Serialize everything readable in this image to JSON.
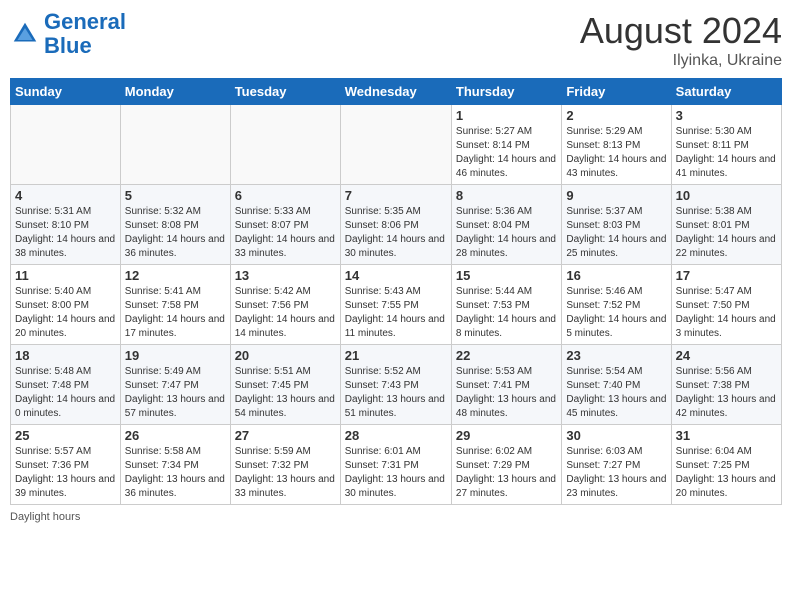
{
  "header": {
    "logo_line1": "General",
    "logo_line2": "Blue",
    "month": "August 2024",
    "location": "Ilyinka, Ukraine"
  },
  "weekdays": [
    "Sunday",
    "Monday",
    "Tuesday",
    "Wednesday",
    "Thursday",
    "Friday",
    "Saturday"
  ],
  "weeks": [
    [
      {
        "day": "",
        "sunrise": "",
        "sunset": "",
        "daylight": ""
      },
      {
        "day": "",
        "sunrise": "",
        "sunset": "",
        "daylight": ""
      },
      {
        "day": "",
        "sunrise": "",
        "sunset": "",
        "daylight": ""
      },
      {
        "day": "",
        "sunrise": "",
        "sunset": "",
        "daylight": ""
      },
      {
        "day": "1",
        "sunrise": "Sunrise: 5:27 AM",
        "sunset": "Sunset: 8:14 PM",
        "daylight": "Daylight: 14 hours and 46 minutes."
      },
      {
        "day": "2",
        "sunrise": "Sunrise: 5:29 AM",
        "sunset": "Sunset: 8:13 PM",
        "daylight": "Daylight: 14 hours and 43 minutes."
      },
      {
        "day": "3",
        "sunrise": "Sunrise: 5:30 AM",
        "sunset": "Sunset: 8:11 PM",
        "daylight": "Daylight: 14 hours and 41 minutes."
      }
    ],
    [
      {
        "day": "4",
        "sunrise": "Sunrise: 5:31 AM",
        "sunset": "Sunset: 8:10 PM",
        "daylight": "Daylight: 14 hours and 38 minutes."
      },
      {
        "day": "5",
        "sunrise": "Sunrise: 5:32 AM",
        "sunset": "Sunset: 8:08 PM",
        "daylight": "Daylight: 14 hours and 36 minutes."
      },
      {
        "day": "6",
        "sunrise": "Sunrise: 5:33 AM",
        "sunset": "Sunset: 8:07 PM",
        "daylight": "Daylight: 14 hours and 33 minutes."
      },
      {
        "day": "7",
        "sunrise": "Sunrise: 5:35 AM",
        "sunset": "Sunset: 8:06 PM",
        "daylight": "Daylight: 14 hours and 30 minutes."
      },
      {
        "day": "8",
        "sunrise": "Sunrise: 5:36 AM",
        "sunset": "Sunset: 8:04 PM",
        "daylight": "Daylight: 14 hours and 28 minutes."
      },
      {
        "day": "9",
        "sunrise": "Sunrise: 5:37 AM",
        "sunset": "Sunset: 8:03 PM",
        "daylight": "Daylight: 14 hours and 25 minutes."
      },
      {
        "day": "10",
        "sunrise": "Sunrise: 5:38 AM",
        "sunset": "Sunset: 8:01 PM",
        "daylight": "Daylight: 14 hours and 22 minutes."
      }
    ],
    [
      {
        "day": "11",
        "sunrise": "Sunrise: 5:40 AM",
        "sunset": "Sunset: 8:00 PM",
        "daylight": "Daylight: 14 hours and 20 minutes."
      },
      {
        "day": "12",
        "sunrise": "Sunrise: 5:41 AM",
        "sunset": "Sunset: 7:58 PM",
        "daylight": "Daylight: 14 hours and 17 minutes."
      },
      {
        "day": "13",
        "sunrise": "Sunrise: 5:42 AM",
        "sunset": "Sunset: 7:56 PM",
        "daylight": "Daylight: 14 hours and 14 minutes."
      },
      {
        "day": "14",
        "sunrise": "Sunrise: 5:43 AM",
        "sunset": "Sunset: 7:55 PM",
        "daylight": "Daylight: 14 hours and 11 minutes."
      },
      {
        "day": "15",
        "sunrise": "Sunrise: 5:44 AM",
        "sunset": "Sunset: 7:53 PM",
        "daylight": "Daylight: 14 hours and 8 minutes."
      },
      {
        "day": "16",
        "sunrise": "Sunrise: 5:46 AM",
        "sunset": "Sunset: 7:52 PM",
        "daylight": "Daylight: 14 hours and 5 minutes."
      },
      {
        "day": "17",
        "sunrise": "Sunrise: 5:47 AM",
        "sunset": "Sunset: 7:50 PM",
        "daylight": "Daylight: 14 hours and 3 minutes."
      }
    ],
    [
      {
        "day": "18",
        "sunrise": "Sunrise: 5:48 AM",
        "sunset": "Sunset: 7:48 PM",
        "daylight": "Daylight: 14 hours and 0 minutes."
      },
      {
        "day": "19",
        "sunrise": "Sunrise: 5:49 AM",
        "sunset": "Sunset: 7:47 PM",
        "daylight": "Daylight: 13 hours and 57 minutes."
      },
      {
        "day": "20",
        "sunrise": "Sunrise: 5:51 AM",
        "sunset": "Sunset: 7:45 PM",
        "daylight": "Daylight: 13 hours and 54 minutes."
      },
      {
        "day": "21",
        "sunrise": "Sunrise: 5:52 AM",
        "sunset": "Sunset: 7:43 PM",
        "daylight": "Daylight: 13 hours and 51 minutes."
      },
      {
        "day": "22",
        "sunrise": "Sunrise: 5:53 AM",
        "sunset": "Sunset: 7:41 PM",
        "daylight": "Daylight: 13 hours and 48 minutes."
      },
      {
        "day": "23",
        "sunrise": "Sunrise: 5:54 AM",
        "sunset": "Sunset: 7:40 PM",
        "daylight": "Daylight: 13 hours and 45 minutes."
      },
      {
        "day": "24",
        "sunrise": "Sunrise: 5:56 AM",
        "sunset": "Sunset: 7:38 PM",
        "daylight": "Daylight: 13 hours and 42 minutes."
      }
    ],
    [
      {
        "day": "25",
        "sunrise": "Sunrise: 5:57 AM",
        "sunset": "Sunset: 7:36 PM",
        "daylight": "Daylight: 13 hours and 39 minutes."
      },
      {
        "day": "26",
        "sunrise": "Sunrise: 5:58 AM",
        "sunset": "Sunset: 7:34 PM",
        "daylight": "Daylight: 13 hours and 36 minutes."
      },
      {
        "day": "27",
        "sunrise": "Sunrise: 5:59 AM",
        "sunset": "Sunset: 7:32 PM",
        "daylight": "Daylight: 13 hours and 33 minutes."
      },
      {
        "day": "28",
        "sunrise": "Sunrise: 6:01 AM",
        "sunset": "Sunset: 7:31 PM",
        "daylight": "Daylight: 13 hours and 30 minutes."
      },
      {
        "day": "29",
        "sunrise": "Sunrise: 6:02 AM",
        "sunset": "Sunset: 7:29 PM",
        "daylight": "Daylight: 13 hours and 27 minutes."
      },
      {
        "day": "30",
        "sunrise": "Sunrise: 6:03 AM",
        "sunset": "Sunset: 7:27 PM",
        "daylight": "Daylight: 13 hours and 23 minutes."
      },
      {
        "day": "31",
        "sunrise": "Sunrise: 6:04 AM",
        "sunset": "Sunset: 7:25 PM",
        "daylight": "Daylight: 13 hours and 20 minutes."
      }
    ]
  ],
  "footer": {
    "daylight_label": "Daylight hours"
  }
}
